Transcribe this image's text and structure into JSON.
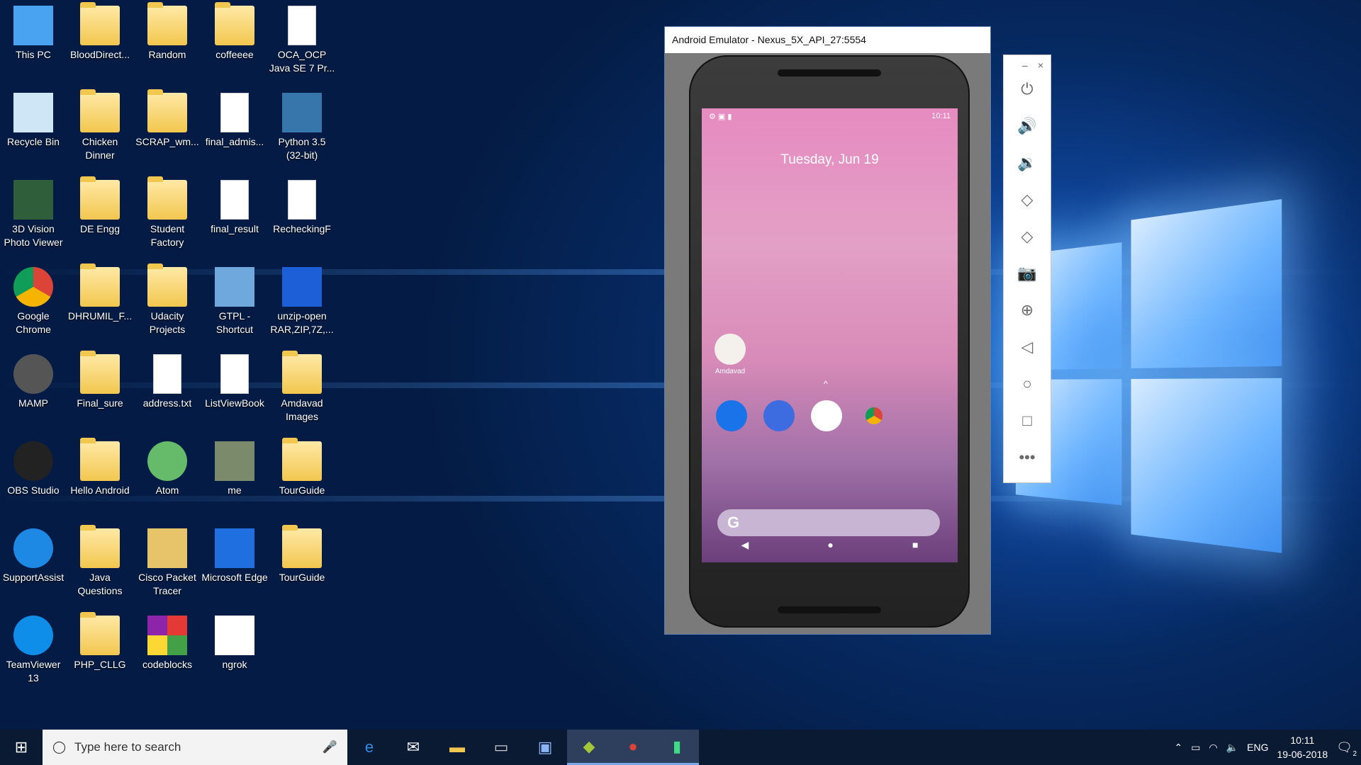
{
  "desktop": {
    "icons": [
      {
        "label": "This PC",
        "icon": "computer-icon"
      },
      {
        "label": "BloodDirect...",
        "icon": "folder-icon"
      },
      {
        "label": "Random",
        "icon": "folder-icon"
      },
      {
        "label": "coffeeee",
        "icon": "folder-icon"
      },
      {
        "label": "OCA_OCP Java SE 7 Pr...",
        "icon": "pdf-icon"
      },
      {
        "label": "Recycle Bin",
        "icon": "recycle-bin-icon"
      },
      {
        "label": "Chicken Dinner",
        "icon": "folder-icon"
      },
      {
        "label": "SCRAP_wm...",
        "icon": "folder-icon"
      },
      {
        "label": "final_admis...",
        "icon": "file-icon"
      },
      {
        "label": "Python 3.5 (32-bit)",
        "icon": "python-icon"
      },
      {
        "label": "3D Vision Photo Viewer",
        "icon": "3d-vision-icon"
      },
      {
        "label": "DE Engg",
        "icon": "folder-icon"
      },
      {
        "label": "Student Factory",
        "icon": "folder-icon"
      },
      {
        "label": "final_result",
        "icon": "file-icon"
      },
      {
        "label": "RecheckingF",
        "icon": "pdf-icon"
      },
      {
        "label": "Google Chrome",
        "icon": "chrome-icon"
      },
      {
        "label": "DHRUMIL_F...",
        "icon": "folder-icon"
      },
      {
        "label": "Udacity Projects",
        "icon": "folder-icon"
      },
      {
        "label": "GTPL - Shortcut",
        "icon": "network-icon"
      },
      {
        "label": "unzip-open RAR,ZIP,7Z,...",
        "icon": "unzip-icon"
      },
      {
        "label": "MAMP",
        "icon": "mamp-icon"
      },
      {
        "label": "Final_sure",
        "icon": "folder-icon"
      },
      {
        "label": "address.txt",
        "icon": "word-doc-icon"
      },
      {
        "label": "ListViewBook",
        "icon": "atom-file-icon"
      },
      {
        "label": "Amdavad Images",
        "icon": "folder-icon"
      },
      {
        "label": "OBS Studio",
        "icon": "obs-icon"
      },
      {
        "label": "Hello Android",
        "icon": "folder-icon"
      },
      {
        "label": "Atom",
        "icon": "atom-icon"
      },
      {
        "label": "me",
        "icon": "photo-icon"
      },
      {
        "label": "TourGuide",
        "icon": "folder-icon"
      },
      {
        "label": "SupportAssist",
        "icon": "support-assist-icon"
      },
      {
        "label": "Java Questions",
        "icon": "folder-icon"
      },
      {
        "label": "Cisco Packet Tracer",
        "icon": "cisco-icon"
      },
      {
        "label": "Microsoft Edge",
        "icon": "edge-icon"
      },
      {
        "label": "TourGuide",
        "icon": "zip-folder-icon"
      },
      {
        "label": "TeamViewer 13",
        "icon": "teamviewer-icon"
      },
      {
        "label": "PHP_CLLG",
        "icon": "folder-icon"
      },
      {
        "label": "codeblocks",
        "icon": "codeblocks-icon"
      },
      {
        "label": "ngrok",
        "icon": "ngrok-icon"
      }
    ]
  },
  "emulator": {
    "title": "Android Emulator - Nexus_5X_API_27:5554",
    "status_time": "10:11",
    "date": "Tuesday, Jun 19",
    "home_app_label": "Amdavad",
    "search_glyph": "G",
    "nav": {
      "back": "◀",
      "home": "●",
      "recents": "■"
    },
    "side_panel": {
      "minimize": "–",
      "close": "×",
      "tools": [
        "power-icon",
        "volume-up-icon",
        "volume-down-icon",
        "rotate-left-icon",
        "rotate-right-icon",
        "camera-icon",
        "zoom-icon",
        "back-icon",
        "home-icon",
        "overview-icon",
        "more-icon"
      ]
    }
  },
  "taskbar": {
    "search_placeholder": "Type here to search",
    "language": "ENG",
    "time": "10:11",
    "date": "19-06-2018",
    "notification_count": "2"
  }
}
